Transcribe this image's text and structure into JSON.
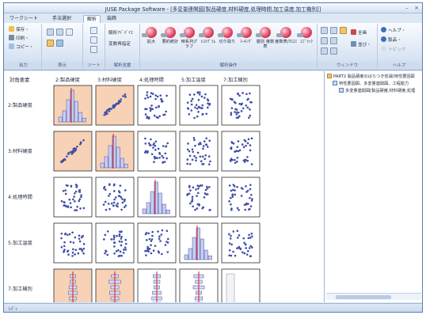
{
  "window": {
    "title": "JUSE Package Software - [多変量連関図[製品硬度,材料硬度,処理時間,加工温度,加工機別]]",
    "minimize": "–",
    "close": "×"
  },
  "tabs": [
    {
      "label": "ワークシート",
      "active": false
    },
    {
      "label": "手法選択",
      "active": false
    },
    {
      "label": "解析",
      "active": true
    },
    {
      "label": "装飾",
      "active": false
    }
  ],
  "ribbon": {
    "groups": {
      "output": "出力",
      "display": "表示",
      "sort": "ソート",
      "analysis_support": "解析支援",
      "analysis_ops": "解析操作",
      "window": "ウィンドウ",
      "help": "ヘルプ"
    },
    "output_items": [
      "保存・",
      "印刷・",
      "コピー・"
    ],
    "analysis_support_items": [
      "解析ｱﾄﾞﾊﾞｲｽ",
      "変数再指定"
    ],
    "big_buttons": [
      "拡大",
      "要約統計",
      "時系列グラフ",
      "ﾋｽﾄｸﾞﾗﾑ",
      "切り取り",
      "ﾏｰｷﾝｸﾞ",
      "層別 度数表",
      "度数表/ｱﾛｺｽ",
      "ｴﾌﾞﾗｯｸ"
    ],
    "window_items": [
      "全画",
      "並び・"
    ],
    "help_items": [
      "ヘルプ・",
      "製品・",
      "トピック"
    ]
  },
  "matrix": {
    "corner_label": "対角要素",
    "variables": [
      {
        "col": "2:製品硬度",
        "row": "2:製品硬度"
      },
      {
        "col": "3:材料硬度",
        "row": "3:材料硬度"
      },
      {
        "col": "4:処理時間",
        "row": "4:処理時間"
      },
      {
        "col": "5:加工温度",
        "row": "5:加工温度"
      },
      {
        "col": "7:加工機別",
        "row": "7:加工機別"
      }
    ],
    "correlated_pair_color": "#f8d2b6",
    "normal_cell_color": "#ffffff",
    "point_color": "#3f4fa8",
    "mean_line_color": "#d42020"
  },
  "tree": {
    "root": "PART2 製品硬度のばらつき低減(特性要因図",
    "child1": "特性要因図、多変量連関図、工程能力",
    "child2": "多変量連関図[製品硬度,材料硬度,処理"
  },
  "status": {
    "text": "ﾚﾃﾞｨ"
  }
}
